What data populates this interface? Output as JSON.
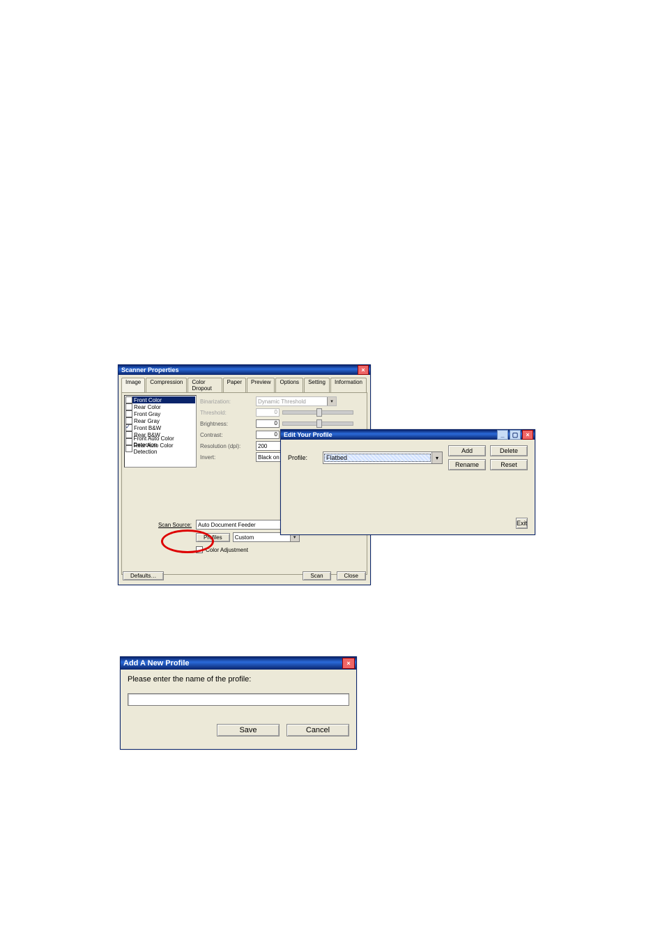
{
  "scanner": {
    "title": "Scanner Properties",
    "tabs": [
      "Image",
      "Compression",
      "Color Dropout",
      "Paper",
      "Preview",
      "Options",
      "Setting",
      "Information"
    ],
    "active_tab": 0,
    "image_list": [
      {
        "label": "Front Color",
        "checked": true,
        "selected": true
      },
      {
        "label": "Rear Color",
        "checked": false
      },
      {
        "label": "Front Gray",
        "checked": false
      },
      {
        "label": "Rear Gray",
        "checked": false
      },
      {
        "label": "Front B&W",
        "checked": true
      },
      {
        "label": "Rear B&W",
        "checked": false
      },
      {
        "label": "Front Auto Color Detection",
        "checked": false
      },
      {
        "label": "Rear Auto Color Detection",
        "checked": false
      }
    ],
    "params": {
      "binarization": {
        "label": "Binarization:",
        "value": "Dynamic Threshold",
        "disabled": true
      },
      "threshold": {
        "label": "Threshold:",
        "value": "0",
        "disabled": true
      },
      "brightness": {
        "label": "Brightness:",
        "value": "0"
      },
      "contrast": {
        "label": "Contrast:",
        "value": "0"
      },
      "resolution": {
        "label": "Resolution (dpi):",
        "value": "200"
      },
      "invert": {
        "label": "Invert:",
        "value": "Black on"
      }
    },
    "scan_source": {
      "label": "Scan Source:",
      "value": "Auto Document Feeder"
    },
    "profiles": {
      "label": "Profiles:",
      "button": "Profiles",
      "value": "Custom"
    },
    "color_adjustment": "Color Adjustment",
    "defaults": "Defaults…",
    "scan": "Scan",
    "close": "Close"
  },
  "edit": {
    "title": "Edit Your Profile",
    "profile_label": "Profile:",
    "profile_value": "Flatbed",
    "buttons": {
      "add": "Add",
      "delete": "Delete",
      "rename": "Rename",
      "reset": "Reset",
      "exit": "Exit"
    }
  },
  "add": {
    "title": "Add A New Profile",
    "prompt": "Please enter the name of the profile:",
    "value": "",
    "save": "Save",
    "cancel": "Cancel"
  }
}
